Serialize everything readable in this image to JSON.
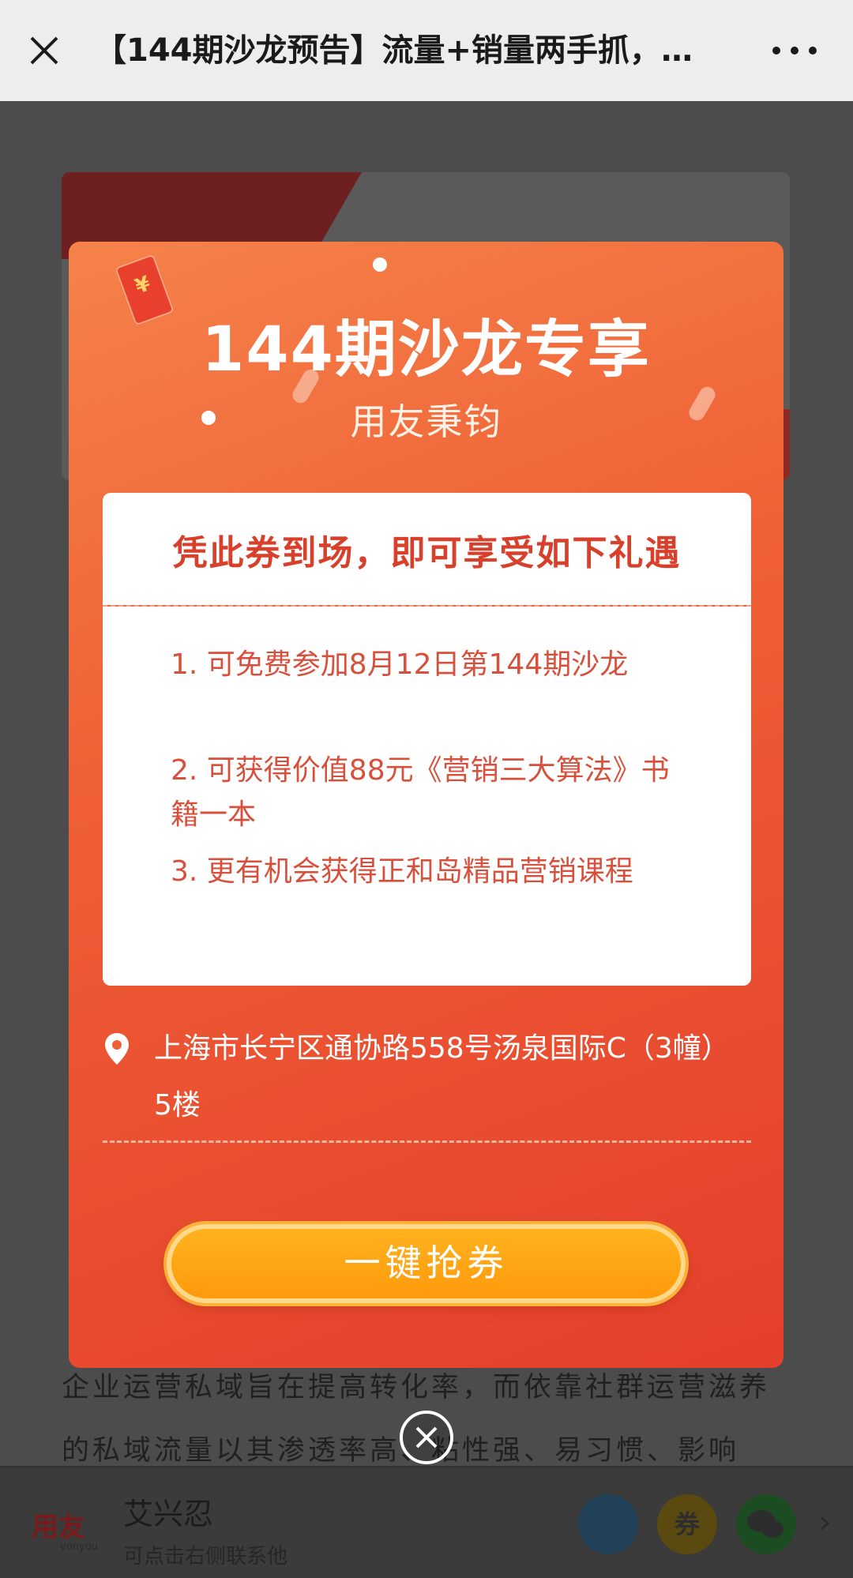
{
  "topbar": {
    "title": "【144期沙龙预告】流量+销量两手抓，…"
  },
  "article": {
    "lines": [
      "企业运营私域旨在提高转化率，而依靠社群运营滋养",
      "的私域流量以其渗透率高、粘性强、易习惯、影响"
    ]
  },
  "coupon": {
    "title": "144期沙龙专享",
    "subtitle": "用友秉钧",
    "envelope_symbol": "¥",
    "ticket_heading": "凭此券到场，即可享受如下礼遇",
    "items": [
      "1. 可免费参加8月12日第144期沙龙",
      "2. 可获得价值88元《营销三大算法》书籍一本",
      "3. 更有机会获得正和岛精品营销课程"
    ],
    "address": "上海市长宁区通协路558号汤泉国际C（3幢）5楼",
    "button_label": "一键抢券"
  },
  "bottombar": {
    "logo_text": "用友",
    "logo_sub": "yonyou",
    "contact_name": "艾兴忍",
    "contact_hint": "可点击右侧联系他",
    "coupon_icon_text": "券"
  },
  "icons": {
    "close": "close-icon",
    "more": "more-icon",
    "location": "location-pin-icon",
    "modal_close": "circle-close-icon",
    "wechat": "wechat-icon",
    "avatar": "avatar-icon",
    "chevron": "chevron-right-icon"
  },
  "colors": {
    "topbar_bg": "#ededed",
    "coupon_orange": "#ef5f35",
    "coupon_red": "#e43f2c",
    "ticket_text": "#d8402b",
    "button_orange": "#ffa414"
  }
}
